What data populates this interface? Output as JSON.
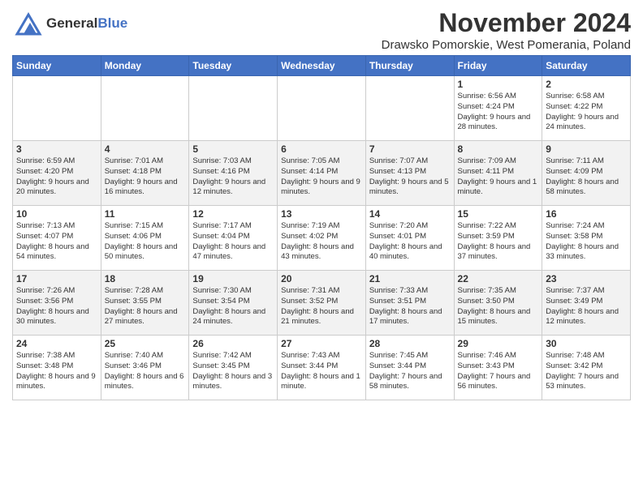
{
  "header": {
    "logo_general": "General",
    "logo_blue": "Blue",
    "month_title": "November 2024",
    "location": "Drawsko Pomorskie, West Pomerania, Poland"
  },
  "weekdays": [
    "Sunday",
    "Monday",
    "Tuesday",
    "Wednesday",
    "Thursday",
    "Friday",
    "Saturday"
  ],
  "weeks": [
    [
      {
        "day": "",
        "info": ""
      },
      {
        "day": "",
        "info": ""
      },
      {
        "day": "",
        "info": ""
      },
      {
        "day": "",
        "info": ""
      },
      {
        "day": "",
        "info": ""
      },
      {
        "day": "1",
        "info": "Sunrise: 6:56 AM\nSunset: 4:24 PM\nDaylight: 9 hours and 28 minutes."
      },
      {
        "day": "2",
        "info": "Sunrise: 6:58 AM\nSunset: 4:22 PM\nDaylight: 9 hours and 24 minutes."
      }
    ],
    [
      {
        "day": "3",
        "info": "Sunrise: 6:59 AM\nSunset: 4:20 PM\nDaylight: 9 hours and 20 minutes."
      },
      {
        "day": "4",
        "info": "Sunrise: 7:01 AM\nSunset: 4:18 PM\nDaylight: 9 hours and 16 minutes."
      },
      {
        "day": "5",
        "info": "Sunrise: 7:03 AM\nSunset: 4:16 PM\nDaylight: 9 hours and 12 minutes."
      },
      {
        "day": "6",
        "info": "Sunrise: 7:05 AM\nSunset: 4:14 PM\nDaylight: 9 hours and 9 minutes."
      },
      {
        "day": "7",
        "info": "Sunrise: 7:07 AM\nSunset: 4:13 PM\nDaylight: 9 hours and 5 minutes."
      },
      {
        "day": "8",
        "info": "Sunrise: 7:09 AM\nSunset: 4:11 PM\nDaylight: 9 hours and 1 minute."
      },
      {
        "day": "9",
        "info": "Sunrise: 7:11 AM\nSunset: 4:09 PM\nDaylight: 8 hours and 58 minutes."
      }
    ],
    [
      {
        "day": "10",
        "info": "Sunrise: 7:13 AM\nSunset: 4:07 PM\nDaylight: 8 hours and 54 minutes."
      },
      {
        "day": "11",
        "info": "Sunrise: 7:15 AM\nSunset: 4:06 PM\nDaylight: 8 hours and 50 minutes."
      },
      {
        "day": "12",
        "info": "Sunrise: 7:17 AM\nSunset: 4:04 PM\nDaylight: 8 hours and 47 minutes."
      },
      {
        "day": "13",
        "info": "Sunrise: 7:19 AM\nSunset: 4:02 PM\nDaylight: 8 hours and 43 minutes."
      },
      {
        "day": "14",
        "info": "Sunrise: 7:20 AM\nSunset: 4:01 PM\nDaylight: 8 hours and 40 minutes."
      },
      {
        "day": "15",
        "info": "Sunrise: 7:22 AM\nSunset: 3:59 PM\nDaylight: 8 hours and 37 minutes."
      },
      {
        "day": "16",
        "info": "Sunrise: 7:24 AM\nSunset: 3:58 PM\nDaylight: 8 hours and 33 minutes."
      }
    ],
    [
      {
        "day": "17",
        "info": "Sunrise: 7:26 AM\nSunset: 3:56 PM\nDaylight: 8 hours and 30 minutes."
      },
      {
        "day": "18",
        "info": "Sunrise: 7:28 AM\nSunset: 3:55 PM\nDaylight: 8 hours and 27 minutes."
      },
      {
        "day": "19",
        "info": "Sunrise: 7:30 AM\nSunset: 3:54 PM\nDaylight: 8 hours and 24 minutes."
      },
      {
        "day": "20",
        "info": "Sunrise: 7:31 AM\nSunset: 3:52 PM\nDaylight: 8 hours and 21 minutes."
      },
      {
        "day": "21",
        "info": "Sunrise: 7:33 AM\nSunset: 3:51 PM\nDaylight: 8 hours and 17 minutes."
      },
      {
        "day": "22",
        "info": "Sunrise: 7:35 AM\nSunset: 3:50 PM\nDaylight: 8 hours and 15 minutes."
      },
      {
        "day": "23",
        "info": "Sunrise: 7:37 AM\nSunset: 3:49 PM\nDaylight: 8 hours and 12 minutes."
      }
    ],
    [
      {
        "day": "24",
        "info": "Sunrise: 7:38 AM\nSunset: 3:48 PM\nDaylight: 8 hours and 9 minutes."
      },
      {
        "day": "25",
        "info": "Sunrise: 7:40 AM\nSunset: 3:46 PM\nDaylight: 8 hours and 6 minutes."
      },
      {
        "day": "26",
        "info": "Sunrise: 7:42 AM\nSunset: 3:45 PM\nDaylight: 8 hours and 3 minutes."
      },
      {
        "day": "27",
        "info": "Sunrise: 7:43 AM\nSunset: 3:44 PM\nDaylight: 8 hours and 1 minute."
      },
      {
        "day": "28",
        "info": "Sunrise: 7:45 AM\nSunset: 3:44 PM\nDaylight: 7 hours and 58 minutes."
      },
      {
        "day": "29",
        "info": "Sunrise: 7:46 AM\nSunset: 3:43 PM\nDaylight: 7 hours and 56 minutes."
      },
      {
        "day": "30",
        "info": "Sunrise: 7:48 AM\nSunset: 3:42 PM\nDaylight: 7 hours and 53 minutes."
      }
    ]
  ]
}
